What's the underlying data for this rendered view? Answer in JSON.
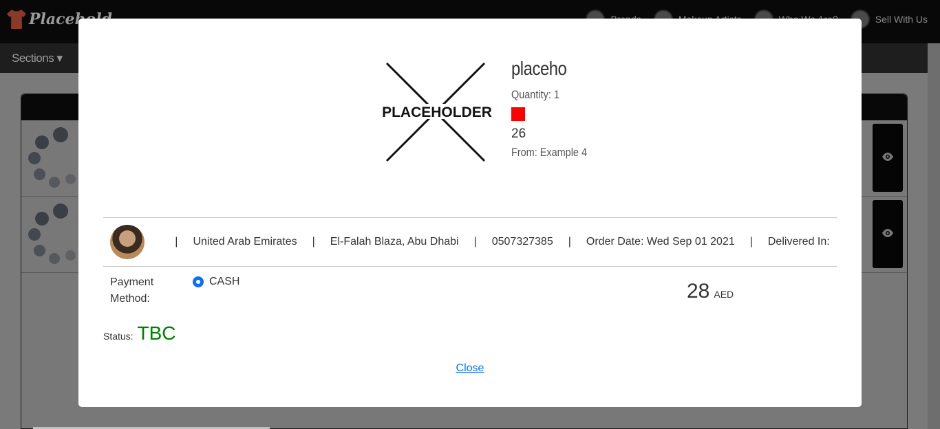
{
  "header": {
    "brand": "Placehold",
    "nav": [
      {
        "label": "Brands"
      },
      {
        "label": "Makeup Artists"
      },
      {
        "label": "Who We Are?"
      },
      {
        "label": "Sell With Us"
      }
    ],
    "sections_label": "Sections",
    "sections_caret": "▾"
  },
  "modal": {
    "product": {
      "image_text": "PLACEHOLDER",
      "name": "placeho",
      "quantity": "Quantity: 1",
      "color": "#ff0000",
      "size": "26",
      "from": "From: Example 4"
    },
    "order": {
      "separator": "|",
      "country": "United Arab Emirates",
      "address": "El-Falah Blaza, Abu Dhabi",
      "phone": "0507327385",
      "order_date": "Order Date: Wed Sep 01 2021",
      "delivered": "Delivered In:"
    },
    "payment": {
      "label_line1": "Payment",
      "label_line2": "Method:",
      "option": "CASH",
      "price": "28",
      "currency": "AED"
    },
    "status": {
      "label": "Status:",
      "value": "TBC"
    },
    "close_label": "Close"
  }
}
